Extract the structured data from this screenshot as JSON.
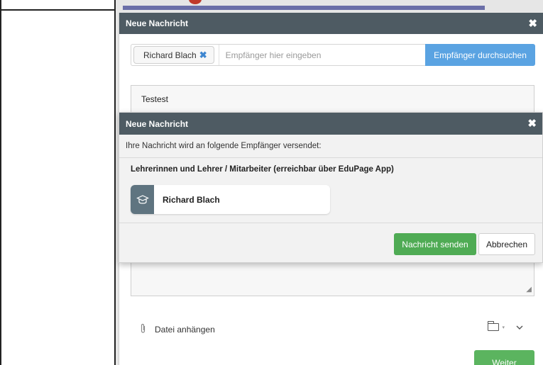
{
  "compose": {
    "title": "Neue Nachricht",
    "close_symbol": "✖",
    "recipient_chip": "Richard Blach",
    "chip_remove_symbol": "✖",
    "recipient_placeholder": "Empfänger hier eingeben",
    "search_button": "Empfänger durchsuchen",
    "message_text": "Testest",
    "attach_label": "Datei anhängen",
    "next_button": "Weiter",
    "icons": {
      "attach": "paperclip-icon",
      "folder": "folder-icon",
      "expand": "chevron-down-icon",
      "close": "close-icon"
    }
  },
  "confirm": {
    "title": "Neue Nachricht",
    "close_symbol": "✖",
    "info_text": "Ihre Nachricht wird an folgende Empfänger versendet:",
    "group_title": "Lehrerinnen und Lehrer / Mitarbeiter (erreichbar über EduPage App)",
    "recipients": [
      {
        "name": "Richard Blach",
        "icon": "teacher-cap-icon"
      }
    ],
    "send_button": "Nachricht senden",
    "cancel_button": "Abbrechen"
  },
  "colors": {
    "header": "#4e5b63",
    "primary_blue": "#5aa3e2",
    "send_green": "#4fab54",
    "weiter_green": "#5bb45f",
    "avatar_bg": "#5f7480"
  }
}
